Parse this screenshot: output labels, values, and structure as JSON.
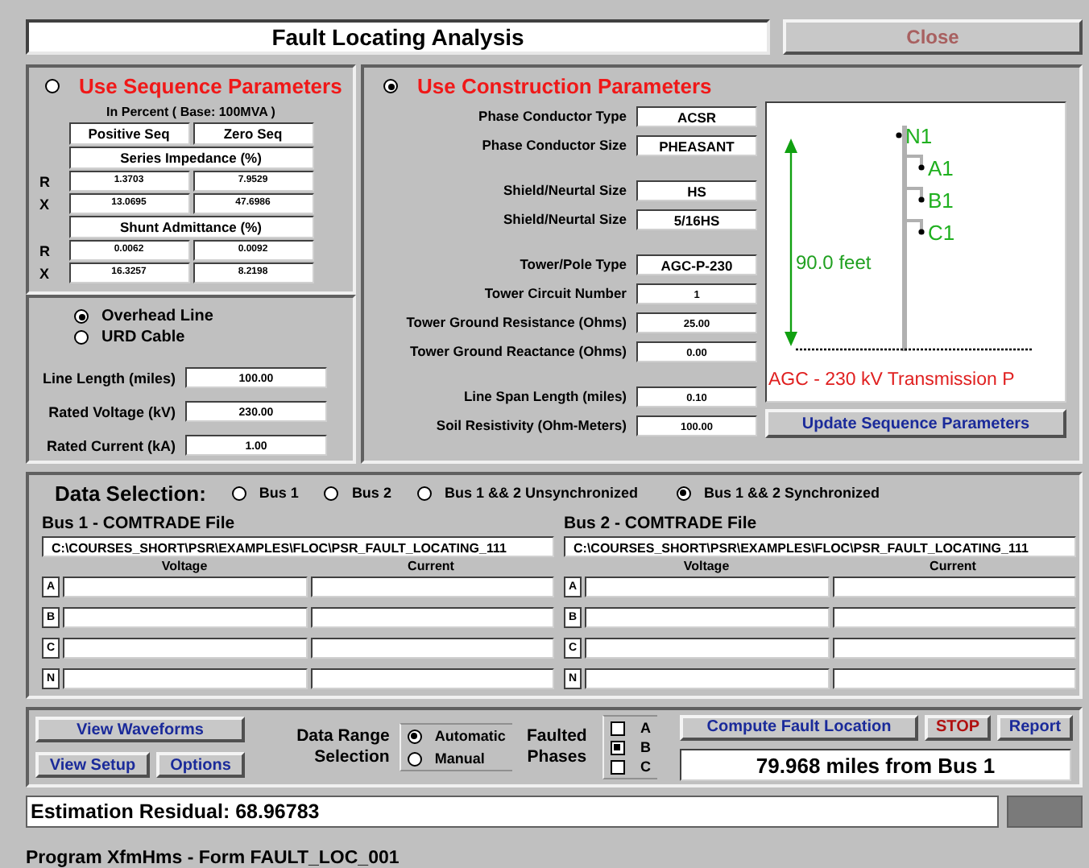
{
  "window": {
    "title": "Fault Locating Analysis",
    "close": "Close"
  },
  "sequence": {
    "label": "Use Sequence Parameters",
    "selected": false,
    "base": "In Percent  ( Base: 100MVA )",
    "headers": [
      "Positive Seq",
      "Zero Seq"
    ],
    "sections": [
      {
        "title": "Series Impedance (%)",
        "rows": [
          {
            "label": "R",
            "values": [
              "1.3703",
              "7.9529"
            ]
          },
          {
            "label": "X",
            "values": [
              "13.0695",
              "47.6986"
            ]
          }
        ]
      },
      {
        "title": "Shunt Admittance (%)",
        "rows": [
          {
            "label": "R",
            "values": [
              "0.0062",
              "0.0092"
            ]
          },
          {
            "label": "X",
            "values": [
              "16.3257",
              "8.2198"
            ]
          }
        ]
      }
    ]
  },
  "line_type": [
    {
      "label": "Overhead Line",
      "selected": true
    },
    {
      "label": "URD Cable",
      "selected": false
    }
  ],
  "line_fields": [
    {
      "label": "Line Length (miles)",
      "value": "100.00"
    },
    {
      "label": "Rated Voltage (kV)",
      "value": "230.00"
    },
    {
      "label": "Rated Current (kA)",
      "value": "1.00"
    }
  ],
  "construction": {
    "label": "Use Construction Parameters",
    "selected": true,
    "groups": [
      [
        {
          "label": "Phase Conductor Type",
          "value": "ACSR",
          "kind": "text"
        },
        {
          "label": "Phase Conductor Size",
          "value": "PHEASANT",
          "kind": "text"
        }
      ],
      [
        {
          "label": "Shield/Neurtal Size",
          "value": "HS",
          "kind": "text"
        },
        {
          "label": "Shield/Neurtal Size",
          "value": "5/16HS",
          "kind": "text"
        }
      ],
      [
        {
          "label": "Tower/Pole Type",
          "value": "AGC-P-230",
          "kind": "text"
        },
        {
          "label": "Tower Circuit Number",
          "value": "1",
          "kind": "number"
        },
        {
          "label": "Tower Ground Resistance (Ohms)",
          "value": "25.00",
          "kind": "number"
        },
        {
          "label": "Tower Ground Reactance (Ohms)",
          "value": "0.00",
          "kind": "number"
        }
      ],
      [
        {
          "label": "Line Span Length (miles)",
          "value": "0.10",
          "kind": "number"
        },
        {
          "label": "Soil Resistivity (Ohm-Meters)",
          "value": "100.00",
          "kind": "number"
        }
      ]
    ],
    "diagram": {
      "height_label": "90.0 feet",
      "conductors": [
        "N1",
        "A1",
        "B1",
        "C1"
      ],
      "caption": "AGC - 230 kV Transmission P"
    },
    "update_button": "Update Sequence Parameters"
  },
  "data_selection": {
    "label": "Data Selection:",
    "options": [
      {
        "label": "Bus 1",
        "selected": false
      },
      {
        "label": "Bus 2",
        "selected": false
      },
      {
        "label": "Bus 1 && 2 Unsynchronized",
        "selected": false
      },
      {
        "label": "Bus 1 && 2 Synchronized",
        "selected": true
      }
    ]
  },
  "buses": [
    {
      "title": "Bus 1 - COMTRADE File",
      "path": "C:\\COURSES_SHORT\\PSR\\EXAMPLES\\FLOC\\PSR_FAULT_LOCATING_111",
      "columns": [
        "Voltage",
        "Current"
      ],
      "phases": [
        "A",
        "B",
        "C",
        "N"
      ]
    },
    {
      "title": "Bus 2 - COMTRADE File",
      "path": "C:\\COURSES_SHORT\\PSR\\EXAMPLES\\FLOC\\PSR_FAULT_LOCATING_111",
      "columns": [
        "Voltage",
        "Current"
      ],
      "phases": [
        "A",
        "B",
        "C",
        "N"
      ]
    }
  ],
  "controls": {
    "view_waveforms": "View Waveforms",
    "view_setup": "View Setup",
    "options": "Options",
    "data_range": {
      "label": "Data Range Selection",
      "options": [
        {
          "label": "Automatic",
          "selected": true
        },
        {
          "label": "Manual",
          "selected": false
        }
      ]
    },
    "faulted": {
      "label": "Faulted Phases",
      "phases": [
        {
          "label": "A",
          "checked": false
        },
        {
          "label": "B",
          "checked": true
        },
        {
          "label": "C",
          "checked": false
        }
      ]
    },
    "compute": "Compute Fault Location",
    "stop": "STOP",
    "report": "Report",
    "result": "79.968 miles from Bus 1"
  },
  "status": {
    "residual": "Estimation Residual: 68.96783",
    "program": "Program XfmHms - Form FAULT_LOC_001"
  }
}
